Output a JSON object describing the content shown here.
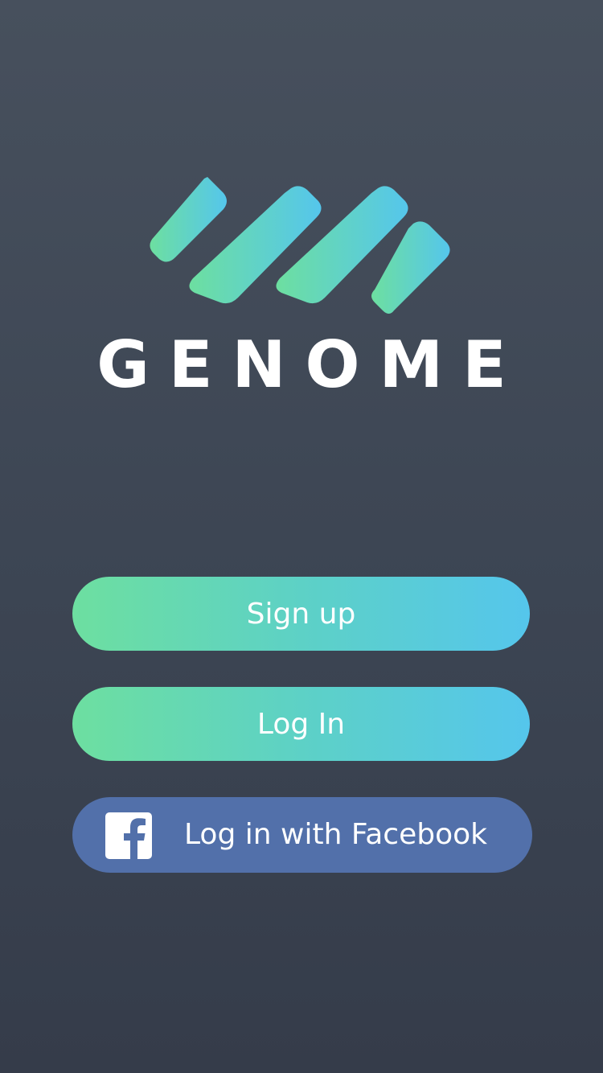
{
  "brand": {
    "name": "GENOME",
    "logo_icon": "genome-stripes-icon",
    "gradient_start": "#6ddfa0",
    "gradient_end": "#55c6ec"
  },
  "actions": {
    "signup_label": "Sign up",
    "login_label": "Log In",
    "facebook_label": "Log in with Facebook",
    "facebook_icon": "facebook-icon",
    "facebook_color": "#5270aa"
  },
  "theme": {
    "background_top": "#47505d",
    "background_bottom": "#353c4a"
  }
}
